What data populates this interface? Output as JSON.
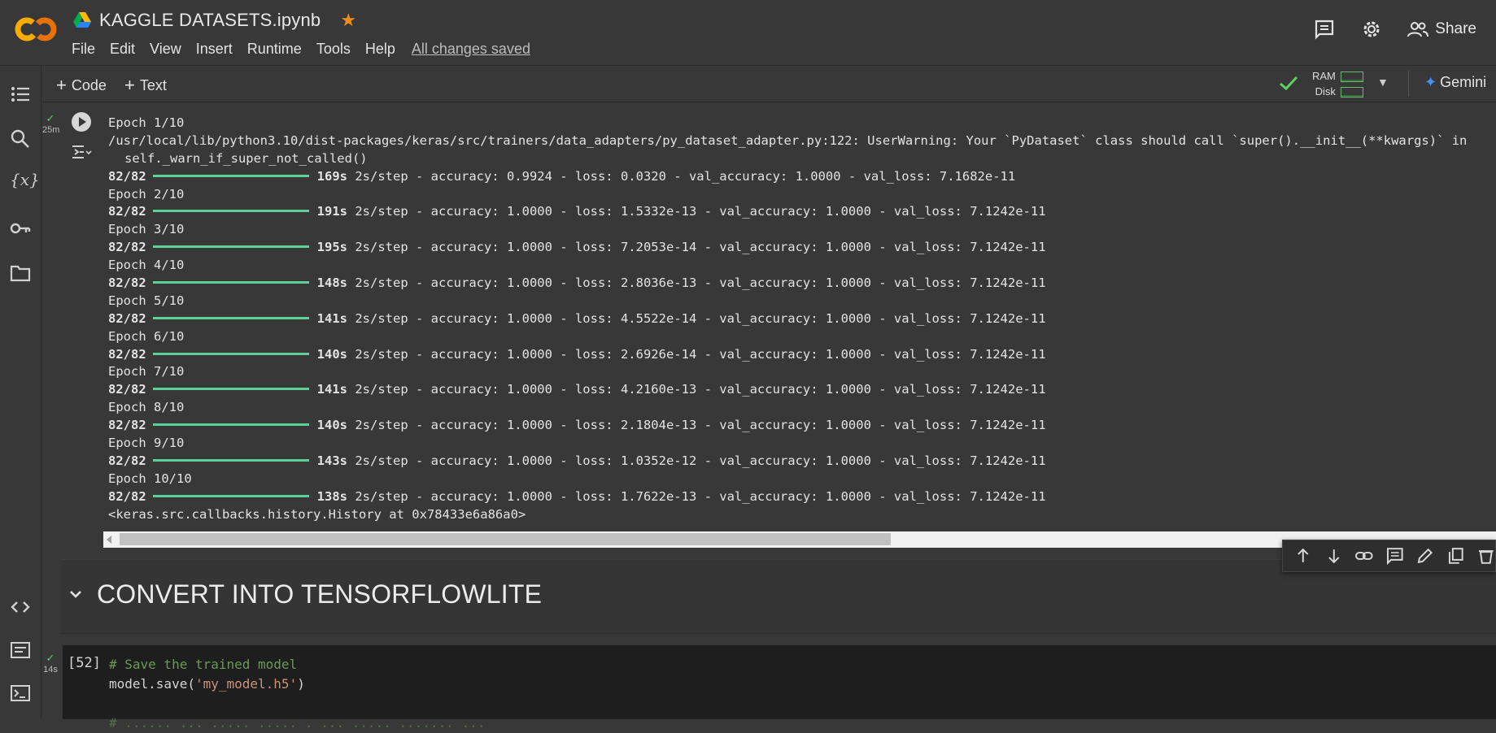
{
  "header": {
    "doc_title": "KAGGLE DATASETS.ipynb",
    "menu": [
      "File",
      "Edit",
      "View",
      "Insert",
      "Runtime",
      "Tools",
      "Help"
    ],
    "save_status": "All changes saved",
    "share_label": "Share"
  },
  "toolbar": {
    "code_label": "Code",
    "text_label": "Text",
    "ram_label": "RAM",
    "disk_label": "Disk",
    "gemini_label": "Gemini"
  },
  "cell": {
    "elapsed": "25m",
    "output": {
      "epoch_first": "Epoch 1/10",
      "warning_line": "/usr/local/lib/python3.10/dist-packages/keras/src/trainers/data_adapters/py_dataset_adapter.py:122: UserWarning: Your `PyDataset` class should call `super().__init__(**kwargs)` in",
      "warning_call": "self._warn_if_super_not_called()",
      "epochs": [
        {
          "epoch": "",
          "steps": "82/82",
          "time": "169s",
          "metrics": "2s/step - accuracy: 0.9924 - loss: 0.0320 - val_accuracy: 1.0000 - val_loss: 7.1682e-11"
        },
        {
          "epoch": "Epoch 2/10",
          "steps": "82/82",
          "time": "191s",
          "metrics": "2s/step - accuracy: 1.0000 - loss: 1.5332e-13 - val_accuracy: 1.0000 - val_loss: 7.1242e-11"
        },
        {
          "epoch": "Epoch 3/10",
          "steps": "82/82",
          "time": "195s",
          "metrics": "2s/step - accuracy: 1.0000 - loss: 7.2053e-14 - val_accuracy: 1.0000 - val_loss: 7.1242e-11"
        },
        {
          "epoch": "Epoch 4/10",
          "steps": "82/82",
          "time": "148s",
          "metrics": "2s/step - accuracy: 1.0000 - loss: 2.8036e-13 - val_accuracy: 1.0000 - val_loss: 7.1242e-11"
        },
        {
          "epoch": "Epoch 5/10",
          "steps": "82/82",
          "time": "141s",
          "metrics": "2s/step - accuracy: 1.0000 - loss: 4.5522e-14 - val_accuracy: 1.0000 - val_loss: 7.1242e-11"
        },
        {
          "epoch": "Epoch 6/10",
          "steps": "82/82",
          "time": "140s",
          "metrics": "2s/step - accuracy: 1.0000 - loss: 2.6926e-14 - val_accuracy: 1.0000 - val_loss: 7.1242e-11"
        },
        {
          "epoch": "Epoch 7/10",
          "steps": "82/82",
          "time": "141s",
          "metrics": "2s/step - accuracy: 1.0000 - loss: 4.2160e-13 - val_accuracy: 1.0000 - val_loss: 7.1242e-11"
        },
        {
          "epoch": "Epoch 8/10",
          "steps": "82/82",
          "time": "140s",
          "metrics": "2s/step - accuracy: 1.0000 - loss: 2.1804e-13 - val_accuracy: 1.0000 - val_loss: 7.1242e-11"
        },
        {
          "epoch": "Epoch 9/10",
          "steps": "82/82",
          "time": "143s",
          "metrics": "2s/step - accuracy: 1.0000 - loss: 1.0352e-12 - val_accuracy: 1.0000 - val_loss: 7.1242e-11"
        },
        {
          "epoch": "Epoch 10/10",
          "steps": "82/82",
          "time": "138s",
          "metrics": "2s/step - accuracy: 1.0000 - loss: 1.7622e-13 - val_accuracy: 1.0000 - val_loss: 7.1242e-11"
        }
      ],
      "result": "<keras.src.callbacks.history.History at 0x78433e6a86a0>"
    }
  },
  "text_cell": {
    "heading": "CONVERT INTO TENSORFLOWLITE"
  },
  "code_cell": {
    "exec_count": "[52]",
    "elapsed": "14s",
    "comment": "# Save the trained model",
    "code_prefix": "model.save(",
    "code_string": "'my_model.h5'",
    "code_suffix": ")",
    "faded_line": "# ...... ... ..... ..... . ... ..... ....... ..."
  },
  "colors": {
    "background": "#383838",
    "accent_orange": "#f28b1b",
    "success_green": "#5ccf65",
    "gemini_blue": "#4b8ff5"
  },
  "icons": [
    "colab-logo",
    "drive-icon",
    "star-icon",
    "comment-icon",
    "gear-icon",
    "people-icon",
    "toc-icon",
    "search-icon",
    "variables-icon",
    "key-icon",
    "folder-icon",
    "code-snippets-icon",
    "command-palette-icon",
    "terminal-icon"
  ]
}
